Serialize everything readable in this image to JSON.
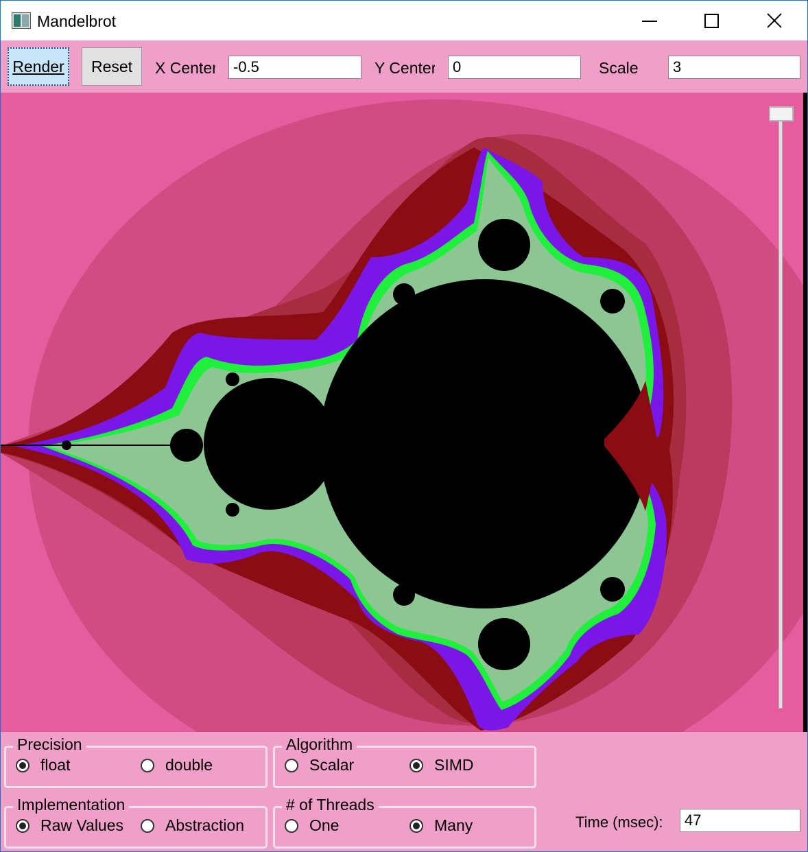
{
  "window": {
    "title": "Mandelbrot",
    "icons": {
      "app": "app-icon",
      "minimize": "minimize-icon",
      "maximize": "maximize-icon",
      "close": "close-icon"
    }
  },
  "toolbar": {
    "render_label": "Render",
    "reset_label": "Reset",
    "x_center_label": "X Center",
    "x_center_value": "-0.5",
    "y_center_label": "Y Center",
    "y_center_value": "0",
    "scale_label": "Scale",
    "scale_value": "3"
  },
  "canvas": {
    "colors": {
      "background": "#e65c9e",
      "set": "#000000",
      "band_dark_red": "#8c0c14",
      "band_purple": "#7a16e8",
      "band_green": "#1ef03c"
    },
    "zoom_slider_level": 0
  },
  "precision": {
    "title": "Precision",
    "options": [
      {
        "label": "float",
        "checked": true
      },
      {
        "label": "double",
        "checked": false
      }
    ]
  },
  "algorithm": {
    "title": "Algorithm",
    "options": [
      {
        "label": "Scalar",
        "checked": false
      },
      {
        "label": "SIMD",
        "checked": true
      }
    ]
  },
  "implementation": {
    "title": "Implementation",
    "options": [
      {
        "label": "Raw Values",
        "checked": true
      },
      {
        "label": "Abstraction",
        "checked": false
      }
    ]
  },
  "threads": {
    "title": "# of Threads",
    "options": [
      {
        "label": "One",
        "checked": false
      },
      {
        "label": "Many",
        "checked": true
      }
    ]
  },
  "time": {
    "label": "Time (msec):",
    "value": "47"
  }
}
